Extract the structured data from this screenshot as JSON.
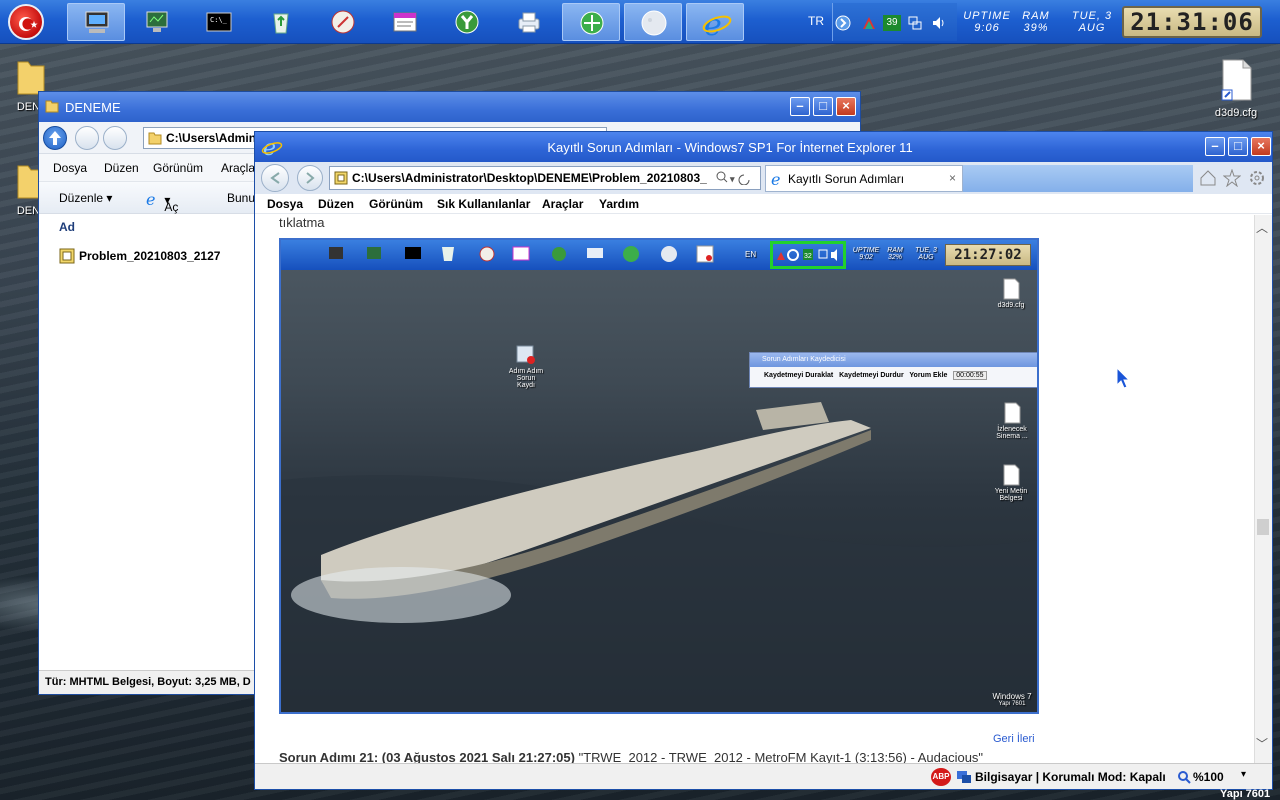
{
  "taskbar": {
    "language": "TR",
    "tray_badge": "39",
    "uptime_label": "UPTIME",
    "uptime_value": "9:06",
    "ram_label": "RAM",
    "ram_value": "39%",
    "date_line1": "TUE, 3",
    "date_line2": "AUG",
    "clock": "21:31:06",
    "buttons": [
      "computer",
      "monitor",
      "cmd",
      "recycle-bin",
      "compass",
      "text-editor",
      "tool-y",
      "printer",
      "network",
      "moon",
      "internet-explorer"
    ]
  },
  "desktop": {
    "icons": [
      {
        "label": "DENI",
        "type": "folder-icon"
      },
      {
        "label": "DENI",
        "type": "folder-icon"
      },
      {
        "label": "d3d9.cfg",
        "type": "file-icon"
      }
    ]
  },
  "explorer": {
    "title": "DENEME",
    "address": "C:\\Users\\Admin",
    "menu": [
      "Dosya",
      "Düzen",
      "Görünüm",
      "Araçla"
    ],
    "commands": {
      "organize": "Düzenle",
      "open": "Aç",
      "burn": "Bunu"
    },
    "column_header": "Ad",
    "file": "Problem_20210803_2127",
    "status": "Tür: MHTML Belgesi, Boyut: 3,25 MB, D"
  },
  "ie": {
    "title": "Kayıtlı Sorun Adımları - Windows7 SP1 For İnternet Explorer 11",
    "address": "C:\\Users\\Administrator\\Desktop\\DENEME\\Problem_20210803_",
    "tab_label": "Kayıtlı Sorun Adımları",
    "menu": [
      "Dosya",
      "Düzen",
      "Görünüm",
      "Sık Kullanılanlar",
      "Araçlar",
      "Yardım"
    ],
    "content": {
      "top_text": "tıklatma",
      "nav_links": "Geri İleri",
      "step_bold": "Sorun Adımı 21: (03 Ağustos 2021 Salı 21:27:05)",
      "step_text": " \"TRWE_2012 - TRWE_2012 - MetroFM Kayıt-1 (3:13:56) - Audacious\""
    },
    "screenshot": {
      "lang": "EN",
      "badge": "32",
      "uptime": "UPTIME 9:02",
      "ram": "RAM 32%",
      "date": "TUE, 3 AUG",
      "clock": "21:27:02",
      "desktop_icon1": "Adım Adım Sorun Kaydı",
      "file1": "d3d9.cfg",
      "file2": "İzlenecek Sinema ...",
      "file3": "Yeni Metin Belgesi",
      "psr_title": "Sorun Adımları Kaydedicisi",
      "psr_pause": "Kaydetmeyi Duraklat",
      "psr_stop": "Kaydetmeyi Durdur",
      "psr_comment": "Yorum Ekle",
      "psr_time": "00:00:55",
      "watermark1": "Windows 7",
      "watermark2": "Yapı 7601"
    },
    "status": {
      "abp": "ABP",
      "zone": "Bilgisayar | Korumalı Mod: Kapalı",
      "zoom": "%100"
    }
  },
  "desktop_watermark": "Yapı 7601"
}
